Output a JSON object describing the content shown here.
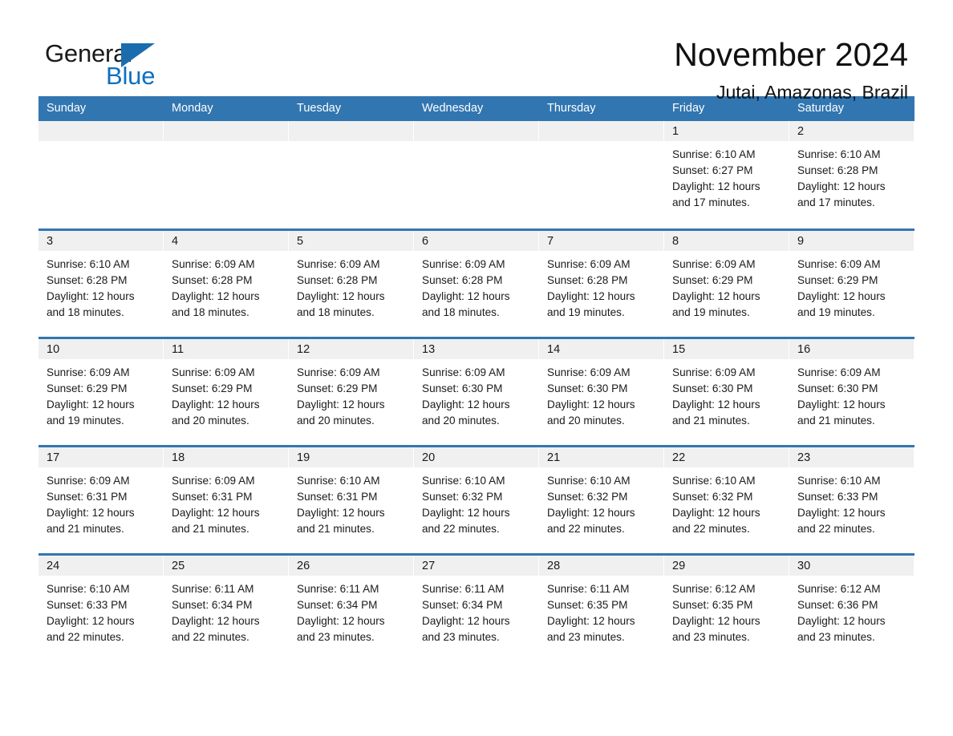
{
  "logo": {
    "word_one": "General",
    "word_two": "Blue",
    "triangle_icon": "triangle-icon",
    "brand_blue": "#0f70c0",
    "brand_blue_dark": "#1b6cad"
  },
  "header": {
    "title": "November 2024",
    "subtitle": "Jutai, Amazonas, Brazil"
  },
  "colors": {
    "header_row_bg": "#3276b1",
    "header_row_text": "#ffffff",
    "daynum_band_bg": "#f0f0f0",
    "row_separator": "#3276b1",
    "body_text": "#1a1a1a",
    "page_bg": "#ffffff"
  },
  "weekday_headers": [
    "Sunday",
    "Monday",
    "Tuesday",
    "Wednesday",
    "Thursday",
    "Friday",
    "Saturday"
  ],
  "labels": {
    "sunrise_prefix": "Sunrise:",
    "sunset_prefix": "Sunset:",
    "daylight_prefix": "Daylight:"
  },
  "weeks": [
    [
      {
        "empty": true,
        "day": "",
        "sunrise": "",
        "sunset": "",
        "daylight_line1": "",
        "daylight_line2": ""
      },
      {
        "empty": true,
        "day": "",
        "sunrise": "",
        "sunset": "",
        "daylight_line1": "",
        "daylight_line2": ""
      },
      {
        "empty": true,
        "day": "",
        "sunrise": "",
        "sunset": "",
        "daylight_line1": "",
        "daylight_line2": ""
      },
      {
        "empty": true,
        "day": "",
        "sunrise": "",
        "sunset": "",
        "daylight_line1": "",
        "daylight_line2": ""
      },
      {
        "empty": true,
        "day": "",
        "sunrise": "",
        "sunset": "",
        "daylight_line1": "",
        "daylight_line2": ""
      },
      {
        "empty": false,
        "day": "1",
        "sunrise": "Sunrise: 6:10 AM",
        "sunset": "Sunset: 6:27 PM",
        "daylight_line1": "Daylight: 12 hours",
        "daylight_line2": "and 17 minutes."
      },
      {
        "empty": false,
        "day": "2",
        "sunrise": "Sunrise: 6:10 AM",
        "sunset": "Sunset: 6:28 PM",
        "daylight_line1": "Daylight: 12 hours",
        "daylight_line2": "and 17 minutes."
      }
    ],
    [
      {
        "empty": false,
        "day": "3",
        "sunrise": "Sunrise: 6:10 AM",
        "sunset": "Sunset: 6:28 PM",
        "daylight_line1": "Daylight: 12 hours",
        "daylight_line2": "and 18 minutes."
      },
      {
        "empty": false,
        "day": "4",
        "sunrise": "Sunrise: 6:09 AM",
        "sunset": "Sunset: 6:28 PM",
        "daylight_line1": "Daylight: 12 hours",
        "daylight_line2": "and 18 minutes."
      },
      {
        "empty": false,
        "day": "5",
        "sunrise": "Sunrise: 6:09 AM",
        "sunset": "Sunset: 6:28 PM",
        "daylight_line1": "Daylight: 12 hours",
        "daylight_line2": "and 18 minutes."
      },
      {
        "empty": false,
        "day": "6",
        "sunrise": "Sunrise: 6:09 AM",
        "sunset": "Sunset: 6:28 PM",
        "daylight_line1": "Daylight: 12 hours",
        "daylight_line2": "and 18 minutes."
      },
      {
        "empty": false,
        "day": "7",
        "sunrise": "Sunrise: 6:09 AM",
        "sunset": "Sunset: 6:28 PM",
        "daylight_line1": "Daylight: 12 hours",
        "daylight_line2": "and 19 minutes."
      },
      {
        "empty": false,
        "day": "8",
        "sunrise": "Sunrise: 6:09 AM",
        "sunset": "Sunset: 6:29 PM",
        "daylight_line1": "Daylight: 12 hours",
        "daylight_line2": "and 19 minutes."
      },
      {
        "empty": false,
        "day": "9",
        "sunrise": "Sunrise: 6:09 AM",
        "sunset": "Sunset: 6:29 PM",
        "daylight_line1": "Daylight: 12 hours",
        "daylight_line2": "and 19 minutes."
      }
    ],
    [
      {
        "empty": false,
        "day": "10",
        "sunrise": "Sunrise: 6:09 AM",
        "sunset": "Sunset: 6:29 PM",
        "daylight_line1": "Daylight: 12 hours",
        "daylight_line2": "and 19 minutes."
      },
      {
        "empty": false,
        "day": "11",
        "sunrise": "Sunrise: 6:09 AM",
        "sunset": "Sunset: 6:29 PM",
        "daylight_line1": "Daylight: 12 hours",
        "daylight_line2": "and 20 minutes."
      },
      {
        "empty": false,
        "day": "12",
        "sunrise": "Sunrise: 6:09 AM",
        "sunset": "Sunset: 6:29 PM",
        "daylight_line1": "Daylight: 12 hours",
        "daylight_line2": "and 20 minutes."
      },
      {
        "empty": false,
        "day": "13",
        "sunrise": "Sunrise: 6:09 AM",
        "sunset": "Sunset: 6:30 PM",
        "daylight_line1": "Daylight: 12 hours",
        "daylight_line2": "and 20 minutes."
      },
      {
        "empty": false,
        "day": "14",
        "sunrise": "Sunrise: 6:09 AM",
        "sunset": "Sunset: 6:30 PM",
        "daylight_line1": "Daylight: 12 hours",
        "daylight_line2": "and 20 minutes."
      },
      {
        "empty": false,
        "day": "15",
        "sunrise": "Sunrise: 6:09 AM",
        "sunset": "Sunset: 6:30 PM",
        "daylight_line1": "Daylight: 12 hours",
        "daylight_line2": "and 21 minutes."
      },
      {
        "empty": false,
        "day": "16",
        "sunrise": "Sunrise: 6:09 AM",
        "sunset": "Sunset: 6:30 PM",
        "daylight_line1": "Daylight: 12 hours",
        "daylight_line2": "and 21 minutes."
      }
    ],
    [
      {
        "empty": false,
        "day": "17",
        "sunrise": "Sunrise: 6:09 AM",
        "sunset": "Sunset: 6:31 PM",
        "daylight_line1": "Daylight: 12 hours",
        "daylight_line2": "and 21 minutes."
      },
      {
        "empty": false,
        "day": "18",
        "sunrise": "Sunrise: 6:09 AM",
        "sunset": "Sunset: 6:31 PM",
        "daylight_line1": "Daylight: 12 hours",
        "daylight_line2": "and 21 minutes."
      },
      {
        "empty": false,
        "day": "19",
        "sunrise": "Sunrise: 6:10 AM",
        "sunset": "Sunset: 6:31 PM",
        "daylight_line1": "Daylight: 12 hours",
        "daylight_line2": "and 21 minutes."
      },
      {
        "empty": false,
        "day": "20",
        "sunrise": "Sunrise: 6:10 AM",
        "sunset": "Sunset: 6:32 PM",
        "daylight_line1": "Daylight: 12 hours",
        "daylight_line2": "and 22 minutes."
      },
      {
        "empty": false,
        "day": "21",
        "sunrise": "Sunrise: 6:10 AM",
        "sunset": "Sunset: 6:32 PM",
        "daylight_line1": "Daylight: 12 hours",
        "daylight_line2": "and 22 minutes."
      },
      {
        "empty": false,
        "day": "22",
        "sunrise": "Sunrise: 6:10 AM",
        "sunset": "Sunset: 6:32 PM",
        "daylight_line1": "Daylight: 12 hours",
        "daylight_line2": "and 22 minutes."
      },
      {
        "empty": false,
        "day": "23",
        "sunrise": "Sunrise: 6:10 AM",
        "sunset": "Sunset: 6:33 PM",
        "daylight_line1": "Daylight: 12 hours",
        "daylight_line2": "and 22 minutes."
      }
    ],
    [
      {
        "empty": false,
        "day": "24",
        "sunrise": "Sunrise: 6:10 AM",
        "sunset": "Sunset: 6:33 PM",
        "daylight_line1": "Daylight: 12 hours",
        "daylight_line2": "and 22 minutes."
      },
      {
        "empty": false,
        "day": "25",
        "sunrise": "Sunrise: 6:11 AM",
        "sunset": "Sunset: 6:34 PM",
        "daylight_line1": "Daylight: 12 hours",
        "daylight_line2": "and 22 minutes."
      },
      {
        "empty": false,
        "day": "26",
        "sunrise": "Sunrise: 6:11 AM",
        "sunset": "Sunset: 6:34 PM",
        "daylight_line1": "Daylight: 12 hours",
        "daylight_line2": "and 23 minutes."
      },
      {
        "empty": false,
        "day": "27",
        "sunrise": "Sunrise: 6:11 AM",
        "sunset": "Sunset: 6:34 PM",
        "daylight_line1": "Daylight: 12 hours",
        "daylight_line2": "and 23 minutes."
      },
      {
        "empty": false,
        "day": "28",
        "sunrise": "Sunrise: 6:11 AM",
        "sunset": "Sunset: 6:35 PM",
        "daylight_line1": "Daylight: 12 hours",
        "daylight_line2": "and 23 minutes."
      },
      {
        "empty": false,
        "day": "29",
        "sunrise": "Sunrise: 6:12 AM",
        "sunset": "Sunset: 6:35 PM",
        "daylight_line1": "Daylight: 12 hours",
        "daylight_line2": "and 23 minutes."
      },
      {
        "empty": false,
        "day": "30",
        "sunrise": "Sunrise: 6:12 AM",
        "sunset": "Sunset: 6:36 PM",
        "daylight_line1": "Daylight: 12 hours",
        "daylight_line2": "and 23 minutes."
      }
    ]
  ]
}
